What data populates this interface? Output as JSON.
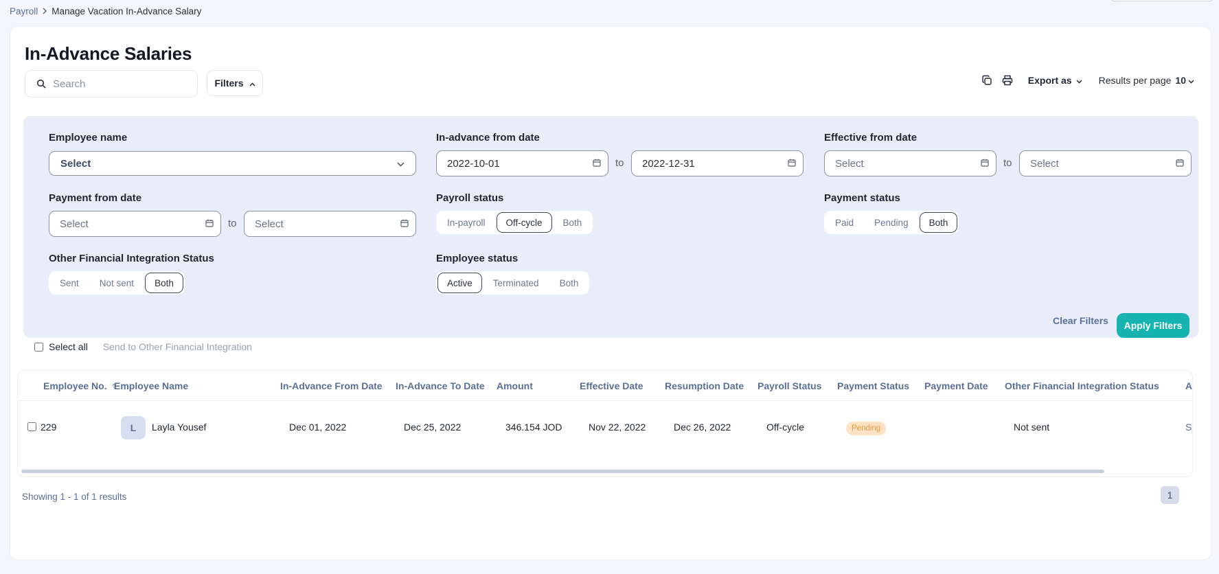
{
  "breadcrumb": {
    "parent": "Payroll",
    "current": "Manage Vacation In-Advance Salary"
  },
  "page": {
    "title": "In-Advance Salaries"
  },
  "search": {
    "placeholder": "Search"
  },
  "toolbar": {
    "filters_label": "Filters",
    "export_label": "Export as",
    "results_per_page_label": "Results per page",
    "results_per_page_value": "10",
    "icons": [
      "copy-icon",
      "print-icon"
    ]
  },
  "filters": {
    "employee_name": {
      "label": "Employee name",
      "value": "Select"
    },
    "in_advance_from_date": {
      "label": "In-advance from date",
      "from": "2022-10-01",
      "to_label": "to",
      "to": "2022-12-31"
    },
    "effective_from_date": {
      "label": "Effective from date",
      "from": "Select",
      "to_label": "to",
      "to": "Select"
    },
    "payment_from_date": {
      "label": "Payment from date",
      "from": "Select",
      "to_label": "to",
      "to": "Select"
    },
    "payroll_status": {
      "label": "Payroll status",
      "options": [
        "In-payroll",
        "Off-cycle",
        "Both"
      ],
      "selected": "Off-cycle"
    },
    "payment_status": {
      "label": "Payment status",
      "options": [
        "Paid",
        "Pending",
        "Both"
      ],
      "selected": "Both"
    },
    "other_financial_integration_status": {
      "label": "Other Financial Integration Status",
      "options": [
        "Sent",
        "Not sent",
        "Both"
      ],
      "selected": "Both"
    },
    "employee_status": {
      "label": "Employee status",
      "options": [
        "Active",
        "Terminated",
        "Both"
      ],
      "selected": "Active"
    },
    "clear_label": "Clear Filters",
    "apply_label": "Apply Filters",
    "accent_color": "#17b3b0"
  },
  "bulk": {
    "select_all_label": "Select all",
    "send_label": "Send to Other Financial Integration"
  },
  "table": {
    "columns": [
      "Employee No.",
      "Employee Name",
      "In-Advance From Date",
      "In-Advance To Date",
      "Amount",
      "Effective Date",
      "Resumption Date",
      "Payroll Status",
      "Payment Status",
      "Payment Date",
      "Other Financial Integration Status",
      "A"
    ],
    "rows": [
      {
        "employee_no": "229",
        "avatar_initial": "L",
        "employee_name": "Layla Yousef",
        "in_advance_from": "Dec 01, 2022",
        "in_advance_to": "Dec 25, 2022",
        "amount": "346.154 JOD",
        "effective_date": "Nov 22, 2022",
        "resumption_date": "Dec 26, 2022",
        "payroll_status": "Off-cycle",
        "payment_status": "Pending",
        "payment_date": "",
        "other_financial_integration_status": "Not sent",
        "truncated_action": "Sl"
      }
    ]
  },
  "pagination": {
    "summary": "Showing 1 - 1 of 1 results",
    "current_page": "1"
  }
}
